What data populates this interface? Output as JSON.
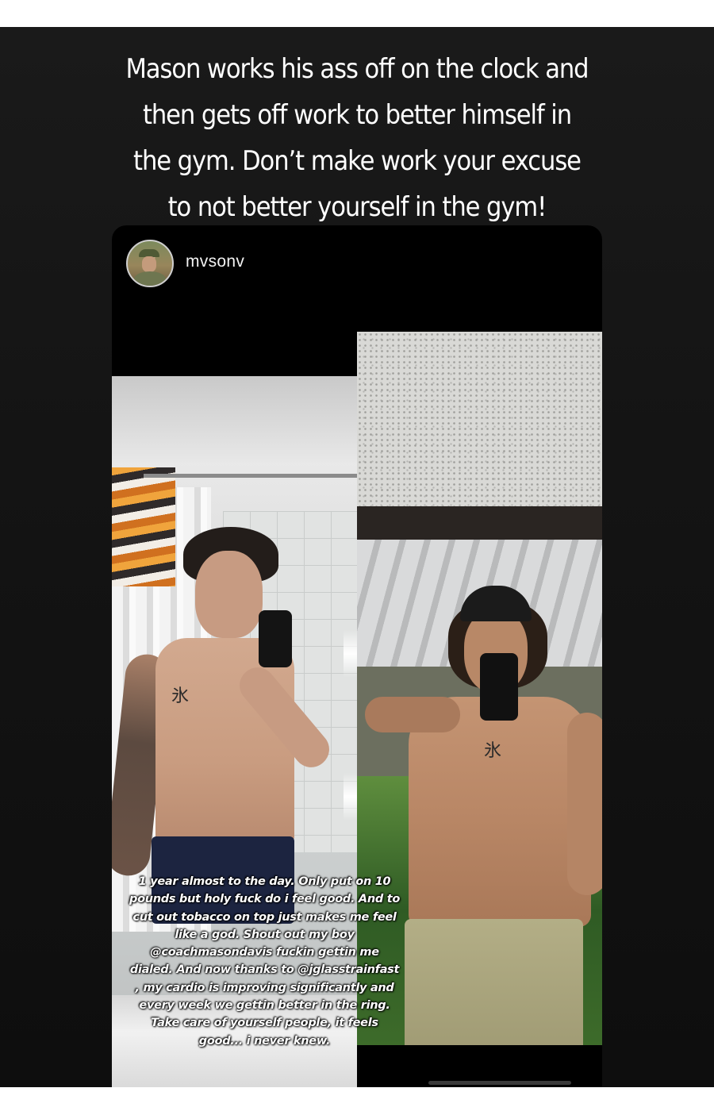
{
  "story": {
    "caption": "Mason works his ass off on the clock and then gets off work to better himself in the gym. Don’t make work your excuse to not better yourself in the gym!"
  },
  "post": {
    "username": "mvsonv",
    "caption": "1 year almost to the day. Only put on 10 pounds but holy fuck do i feel good. And to cut out tobacco on top just makes me feel like a god. Shout out my boy @coachmasondavis fuckin gettin me dialed. And now thanks to @jglasstrainfast , my cardio is improving significantly and every week we gettin better in the ring. Take care of yourself people, it feels good... i never knew.",
    "tattoo_glyph": "氷"
  },
  "icons": {
    "avatar": "profile-photo"
  }
}
